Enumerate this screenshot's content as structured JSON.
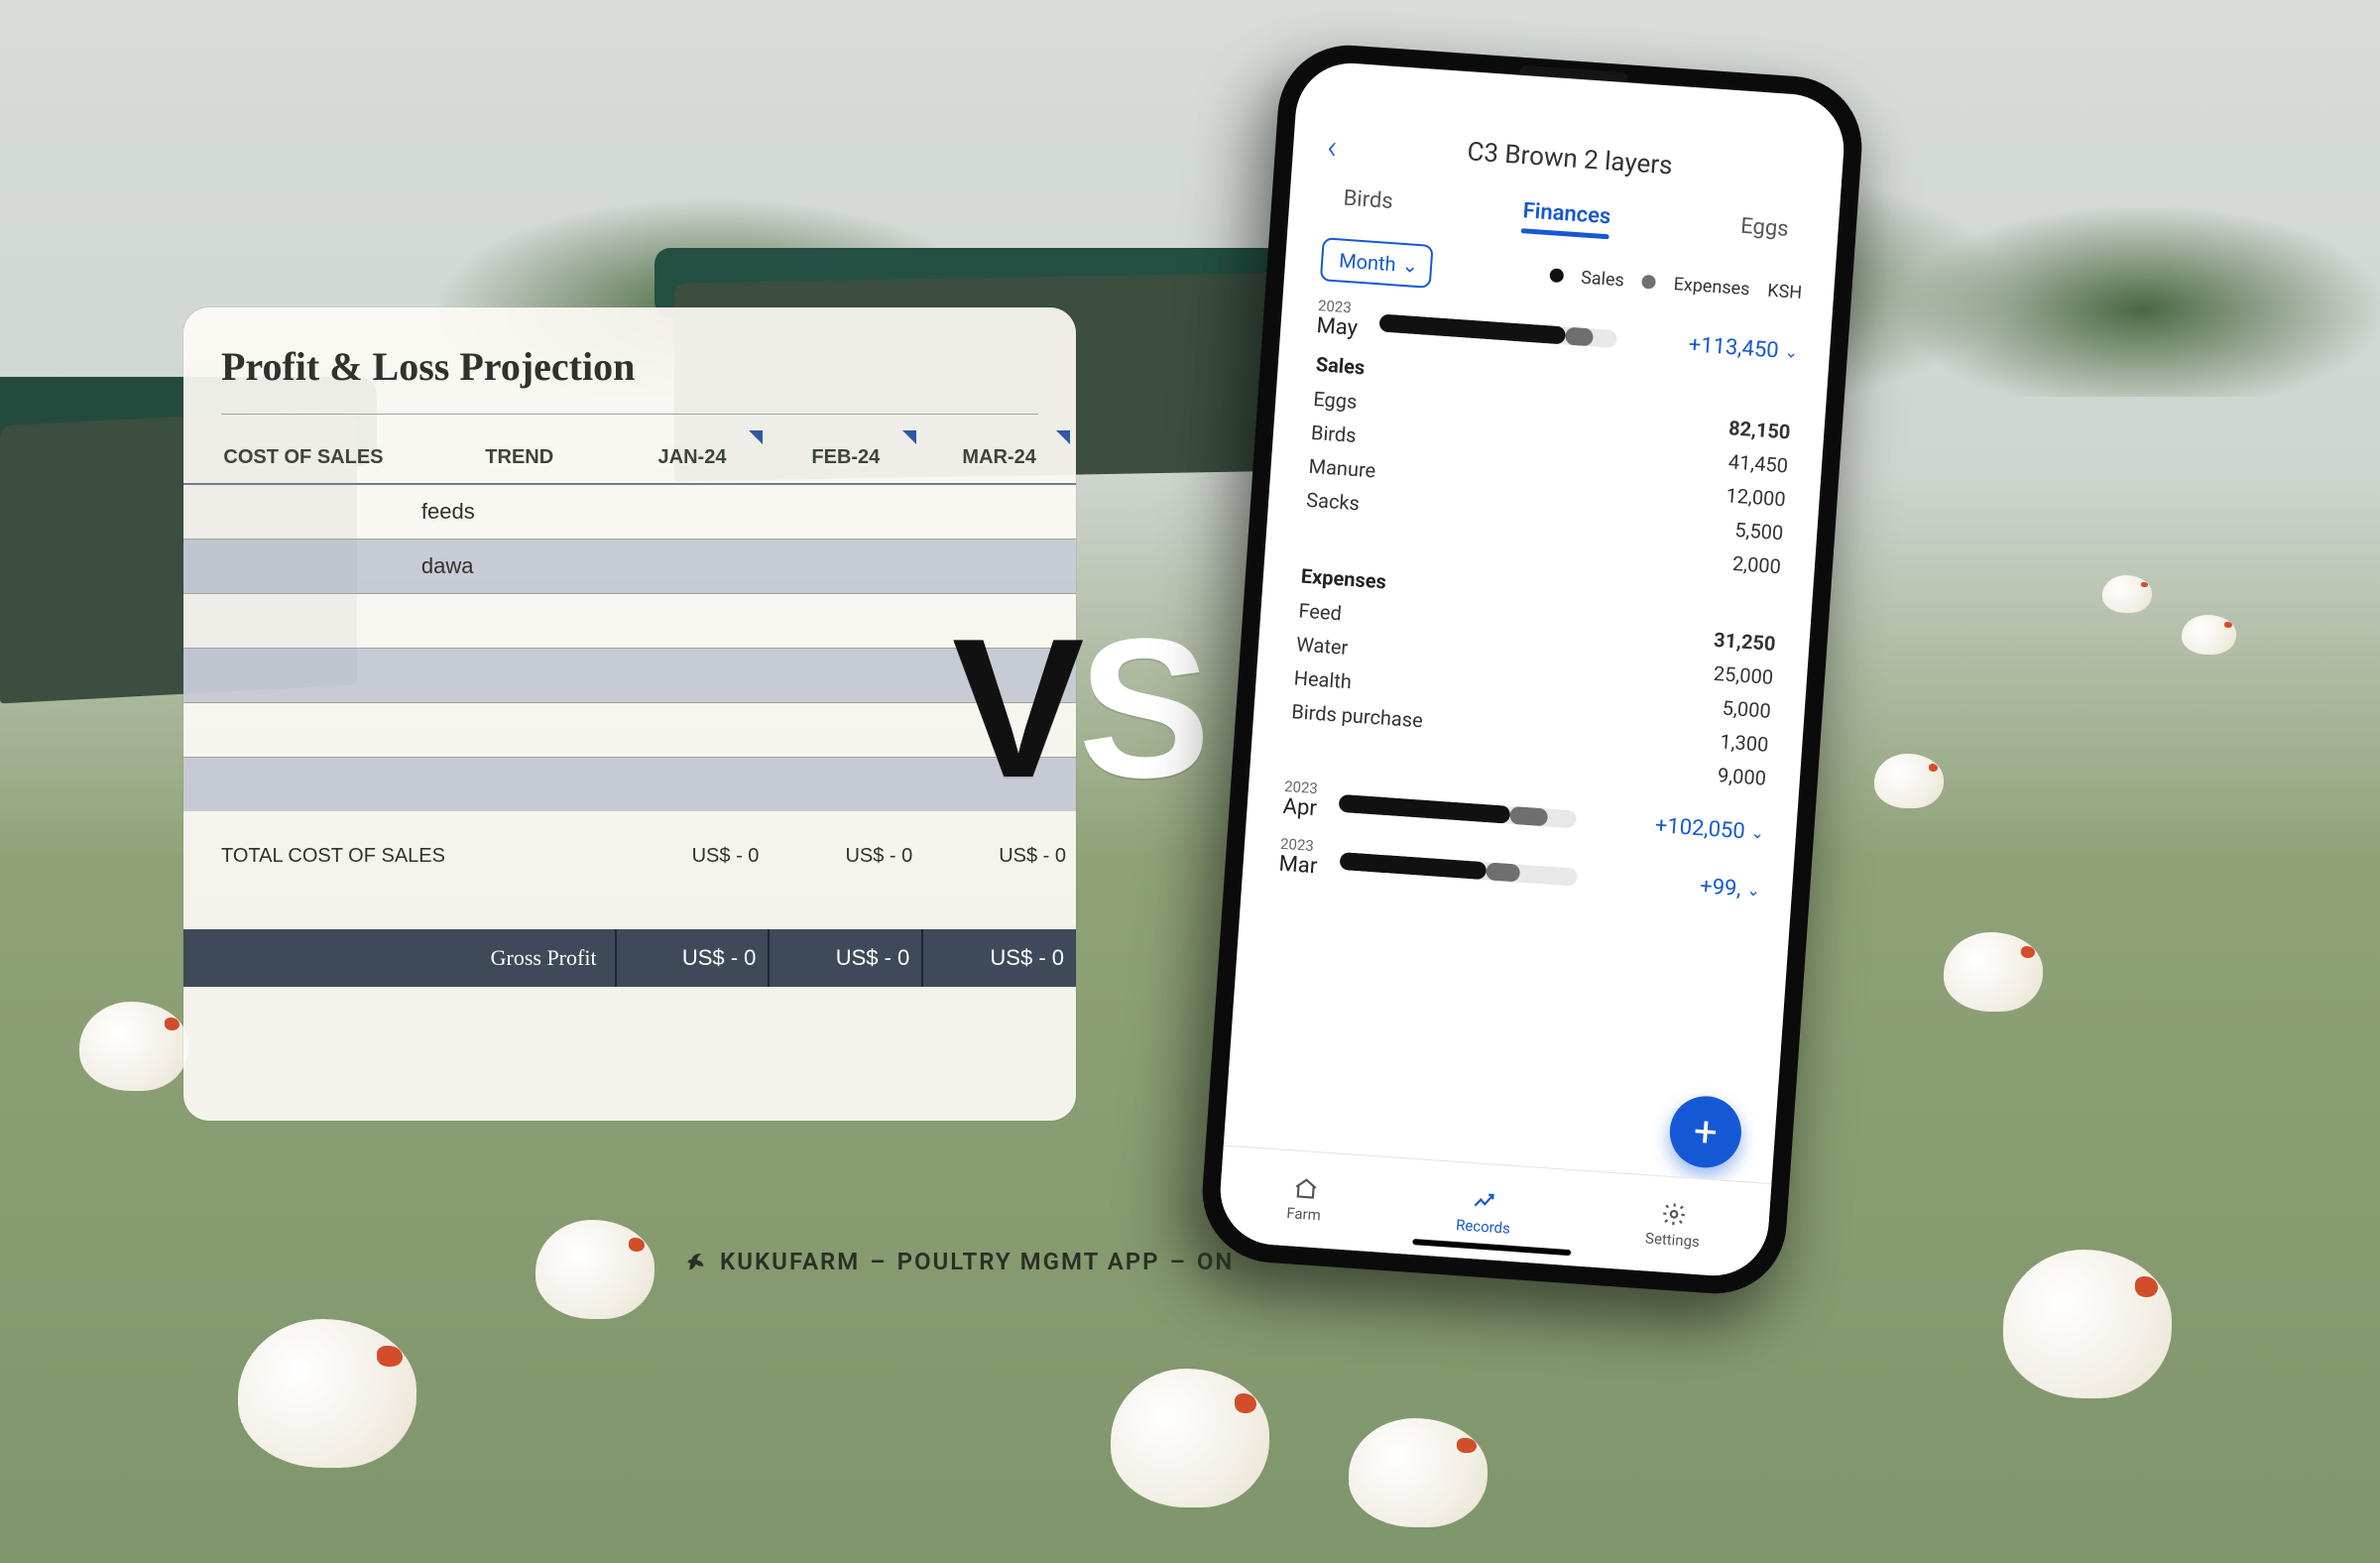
{
  "vs_text": {
    "v": "V",
    "s": "S"
  },
  "brand": {
    "name": "KUKUFARM",
    "sep1": "–",
    "tag": "POULTRY MGMT APP",
    "sep2": "–",
    "on": "ON"
  },
  "spreadsheet": {
    "title": "Profit & Loss Projection",
    "headers": {
      "cost": "COST OF SALES",
      "trend": "TREND",
      "m1": "JAN-24",
      "m2": "FEB-24",
      "m3": "MAR-24"
    },
    "rows": [
      "feeds",
      "dawa"
    ],
    "total_label": "TOTAL COST OF SALES",
    "usd_zero": "US$    - 0",
    "gross_profit_label": "Gross Profit",
    "gp_val": "US$   - 0"
  },
  "phone": {
    "title": "C3 Brown 2 layers",
    "tabs": {
      "birds": "Birds",
      "finances": "Finances",
      "eggs": "Eggs"
    },
    "month_btn": "Month",
    "legend": {
      "sales": "Sales",
      "expenses": "Expenses",
      "currency": "KSH"
    },
    "months": [
      {
        "year": "2023",
        "name": "May",
        "amount": "+113,450",
        "sales_pct": 78,
        "exp_pct": 12,
        "sales_header": "Sales",
        "sales": [
          {
            "k": "Eggs",
            "v": "82,150",
            "bold": true
          },
          {
            "k": "Birds",
            "v": "41,450"
          },
          {
            "k": "Manure",
            "v": "12,000"
          },
          {
            "k": "Sacks",
            "v": "5,500"
          },
          {
            "k": "",
            "v": "2,000"
          }
        ],
        "exp_header": "Expenses",
        "expenses": [
          {
            "k": "Feed",
            "v": "31,250",
            "bold": true
          },
          {
            "k": "Water",
            "v": "25,000"
          },
          {
            "k": "Health",
            "v": "5,000"
          },
          {
            "k": "Birds purchase",
            "v": "1,300"
          },
          {
            "k": "",
            "v": "9,000"
          }
        ]
      },
      {
        "year": "2023",
        "name": "Apr",
        "amount": "+102,050",
        "sales_pct": 72,
        "exp_pct": 16
      },
      {
        "year": "2023",
        "name": "Mar",
        "amount": "+99,",
        "sales_pct": 62,
        "exp_pct": 14
      }
    ],
    "nav": {
      "farm": "Farm",
      "records": "Records",
      "settings": "Settings"
    }
  }
}
